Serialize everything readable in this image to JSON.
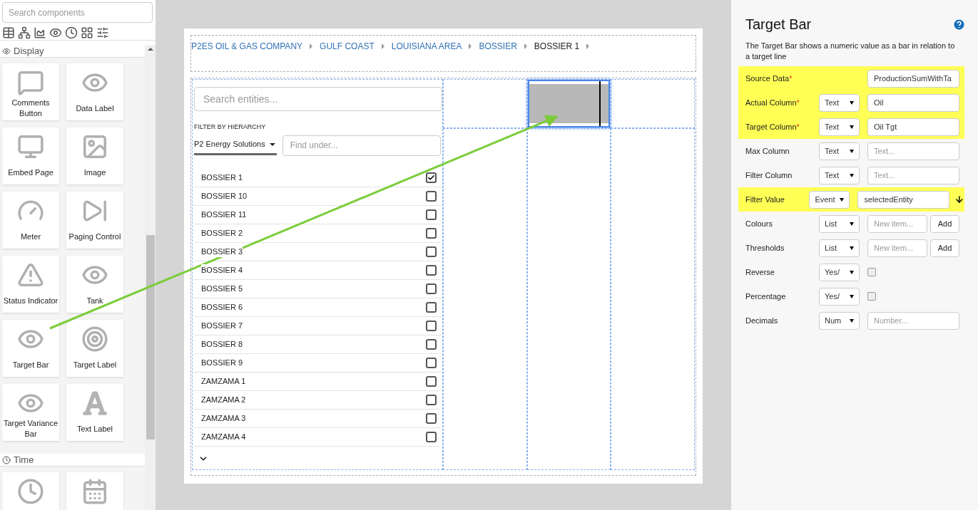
{
  "palette": {
    "search": {
      "placeholder": "Search components"
    },
    "sections": [
      {
        "title": "Display",
        "kind": "eye",
        "items": [
          {
            "label": "Comments Button",
            "kind": "comments"
          },
          {
            "label": "Data Label",
            "kind": "eye"
          },
          {
            "label": "Embed Page",
            "kind": "monitor"
          },
          {
            "label": "Image",
            "kind": "image"
          },
          {
            "label": "Meter",
            "kind": "meter"
          },
          {
            "label": "Paging Control",
            "kind": "paging"
          },
          {
            "label": "Status Indicator",
            "kind": "warning"
          },
          {
            "label": "Tank",
            "kind": "eye"
          },
          {
            "label": "Target Bar",
            "kind": "eye"
          },
          {
            "label": "Target Label",
            "kind": "target"
          },
          {
            "label": "Target Variance Bar",
            "kind": "eye"
          },
          {
            "label": "Text Label",
            "kind": "letter"
          }
        ]
      },
      {
        "title": "Time",
        "kind": "clock",
        "items": [
          {
            "kind": "clock"
          },
          {
            "kind": "calendar"
          }
        ]
      }
    ]
  },
  "breadcrumbs": [
    {
      "label": "P2ES OIL & GAS COMPANY",
      "selected": false
    },
    {
      "label": "GULF COAST",
      "selected": false
    },
    {
      "label": "LOUISIANA AREA",
      "selected": false
    },
    {
      "label": "BOSSIER",
      "selected": false
    },
    {
      "label": "BOSSIER 1",
      "selected": true
    }
  ],
  "entity_list": {
    "search": {
      "placeholder": "Search entities..."
    },
    "filter_label": "FILTER BY HIERARCHY",
    "hierarchy": "P2 Energy Solutions",
    "find": {
      "placeholder": "Find under..."
    },
    "items": [
      {
        "label": "BOSSIER 1",
        "checked": true
      },
      {
        "label": "BOSSIER 10",
        "checked": false
      },
      {
        "label": "BOSSIER 11",
        "checked": false
      },
      {
        "label": "BOSSIER 2",
        "checked": false
      },
      {
        "label": "BOSSIER 3",
        "checked": false
      },
      {
        "label": "BOSSIER 4",
        "checked": false
      },
      {
        "label": "BOSSIER 5",
        "checked": false
      },
      {
        "label": "BOSSIER 6",
        "checked": false
      },
      {
        "label": "BOSSIER 7",
        "checked": false
      },
      {
        "label": "BOSSIER 8",
        "checked": false
      },
      {
        "label": "BOSSIER 9",
        "checked": false
      },
      {
        "label": "ZAMZAMA 1",
        "checked": false
      },
      {
        "label": "ZAMZAMA 2",
        "checked": false
      },
      {
        "label": "ZAMZAMA 3",
        "checked": false
      },
      {
        "label": "ZAMZAMA 4",
        "checked": false
      }
    ]
  },
  "properties": {
    "title": "Target Bar",
    "description": "The Target Bar shows a numeric value as a bar in relation to a target line",
    "fields": [
      {
        "label": "Source Data",
        "required_mark": "*",
        "highlighted": true,
        "kind": "input",
        "value": "ProductionSumWithTa"
      },
      {
        "label": "Actual Column",
        "required_mark": "*",
        "highlighted": true,
        "kind": "select_input",
        "select": "Text",
        "value": "Oil"
      },
      {
        "label": "Target Column",
        "required_mark": "*",
        "highlighted": true,
        "kind": "select_input",
        "select": "Text",
        "value": "Oil Tgt"
      },
      {
        "label": "Max Column",
        "highlighted": false,
        "kind": "select_input",
        "select": "Text",
        "placeholder": "Text..."
      },
      {
        "label": "Filter Column",
        "highlighted": false,
        "kind": "select_input",
        "select": "Text",
        "placeholder": "Text..."
      },
      {
        "label": "Filter Value",
        "highlighted": true,
        "kind": "select_input",
        "select": "Event",
        "value": "selectedEntity",
        "linked": true
      },
      {
        "label": "Colours",
        "highlighted": false,
        "kind": "select_list",
        "select": "List",
        "placeholder": "New item...",
        "button": "Add"
      },
      {
        "label": "Thresholds",
        "highlighted": false,
        "kind": "select_list",
        "select": "List",
        "placeholder": "New item...",
        "button": "Add"
      },
      {
        "label": "Reverse",
        "highlighted": false,
        "kind": "select_check",
        "select": "Yes/",
        "checked": false
      },
      {
        "label": "Percentage",
        "highlighted": false,
        "kind": "select_check",
        "select": "Yes/",
        "checked": false
      },
      {
        "label": "Decimals",
        "highlighted": false,
        "kind": "select_input",
        "select": "Num",
        "placeholder": "Number..."
      }
    ]
  }
}
